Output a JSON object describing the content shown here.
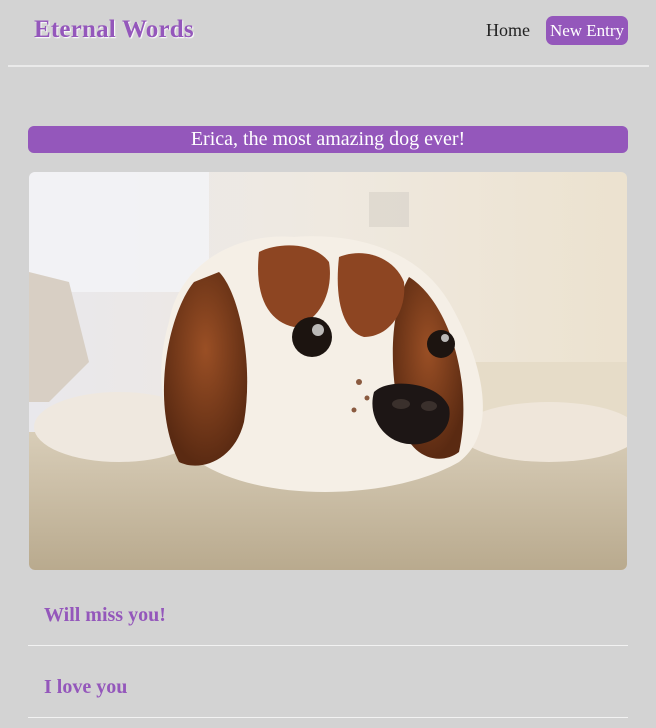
{
  "header": {
    "brand": "Eternal Words",
    "nav": {
      "home_label": "Home",
      "new_entry_label": "New Entry"
    }
  },
  "entry": {
    "title": "Erica, the most amazing dog ever!",
    "photo_subject": "cavalier-spaniel-lying-on-carpet"
  },
  "messages": [
    {
      "text": "Will miss you!"
    },
    {
      "text": "I love you"
    }
  ],
  "colors": {
    "accent": "#9457bb",
    "background": "#d3d3d3",
    "divider": "#f2f2f2"
  }
}
